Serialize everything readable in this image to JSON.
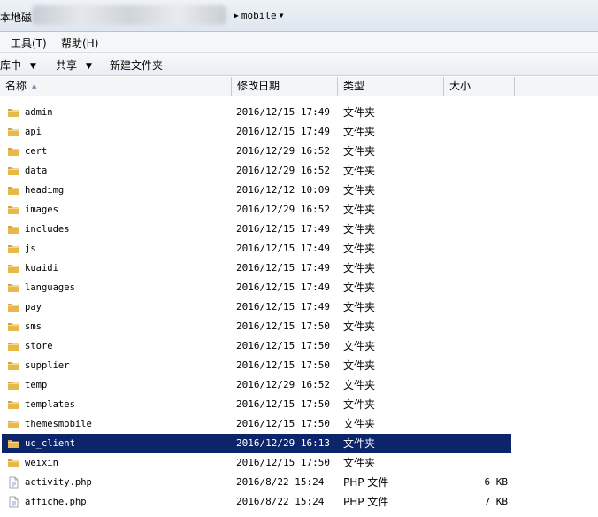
{
  "address": {
    "left_text": "本地磁",
    "segment": "mobile"
  },
  "menu": {
    "tools": "工具(T)",
    "help": "帮助(H)"
  },
  "commands": {
    "library": "库中",
    "share": "共享",
    "new_folder": "新建文件夹"
  },
  "columns": {
    "name": "名称",
    "date": "修改日期",
    "type": "类型",
    "size": "大小"
  },
  "colors": {
    "selection": "#0c246a",
    "folder": "#e8b94a"
  },
  "rows": [
    {
      "name": "admin",
      "date": "2016/12/15 17:49",
      "type": "文件夹",
      "size": "",
      "icon": "folder-icon"
    },
    {
      "name": "api",
      "date": "2016/12/15 17:49",
      "type": "文件夹",
      "size": "",
      "icon": "folder-icon"
    },
    {
      "name": "cert",
      "date": "2016/12/29 16:52",
      "type": "文件夹",
      "size": "",
      "icon": "folder-icon"
    },
    {
      "name": "data",
      "date": "2016/12/29 16:52",
      "type": "文件夹",
      "size": "",
      "icon": "folder-icon"
    },
    {
      "name": "headimg",
      "date": "2016/12/12 10:09",
      "type": "文件夹",
      "size": "",
      "icon": "folder-icon"
    },
    {
      "name": "images",
      "date": "2016/12/29 16:52",
      "type": "文件夹",
      "size": "",
      "icon": "folder-icon"
    },
    {
      "name": "includes",
      "date": "2016/12/15 17:49",
      "type": "文件夹",
      "size": "",
      "icon": "folder-icon"
    },
    {
      "name": "js",
      "date": "2016/12/15 17:49",
      "type": "文件夹",
      "size": "",
      "icon": "folder-icon"
    },
    {
      "name": "kuaidi",
      "date": "2016/12/15 17:49",
      "type": "文件夹",
      "size": "",
      "icon": "folder-icon"
    },
    {
      "name": "languages",
      "date": "2016/12/15 17:49",
      "type": "文件夹",
      "size": "",
      "icon": "folder-icon"
    },
    {
      "name": "pay",
      "date": "2016/12/15 17:49",
      "type": "文件夹",
      "size": "",
      "icon": "folder-icon"
    },
    {
      "name": "sms",
      "date": "2016/12/15 17:50",
      "type": "文件夹",
      "size": "",
      "icon": "folder-icon"
    },
    {
      "name": "store",
      "date": "2016/12/15 17:50",
      "type": "文件夹",
      "size": "",
      "icon": "folder-icon"
    },
    {
      "name": "supplier",
      "date": "2016/12/15 17:50",
      "type": "文件夹",
      "size": "",
      "icon": "folder-icon"
    },
    {
      "name": "temp",
      "date": "2016/12/29 16:52",
      "type": "文件夹",
      "size": "",
      "icon": "folder-icon"
    },
    {
      "name": "templates",
      "date": "2016/12/15 17:50",
      "type": "文件夹",
      "size": "",
      "icon": "folder-icon"
    },
    {
      "name": "themesmobile",
      "date": "2016/12/15 17:50",
      "type": "文件夹",
      "size": "",
      "icon": "folder-icon"
    },
    {
      "name": "uc_client",
      "date": "2016/12/29 16:13",
      "type": "文件夹",
      "size": "",
      "icon": "folder-icon",
      "selected": true
    },
    {
      "name": "weixin",
      "date": "2016/12/15 17:50",
      "type": "文件夹",
      "size": "",
      "icon": "folder-icon"
    },
    {
      "name": "activity.php",
      "date": "2016/8/22 15:24",
      "type": "PHP 文件",
      "size": "6 KB",
      "icon": "php-file-icon"
    },
    {
      "name": "affiche.php",
      "date": "2016/8/22 15:24",
      "type": "PHP 文件",
      "size": "7 KB",
      "icon": "php-file-icon"
    }
  ]
}
